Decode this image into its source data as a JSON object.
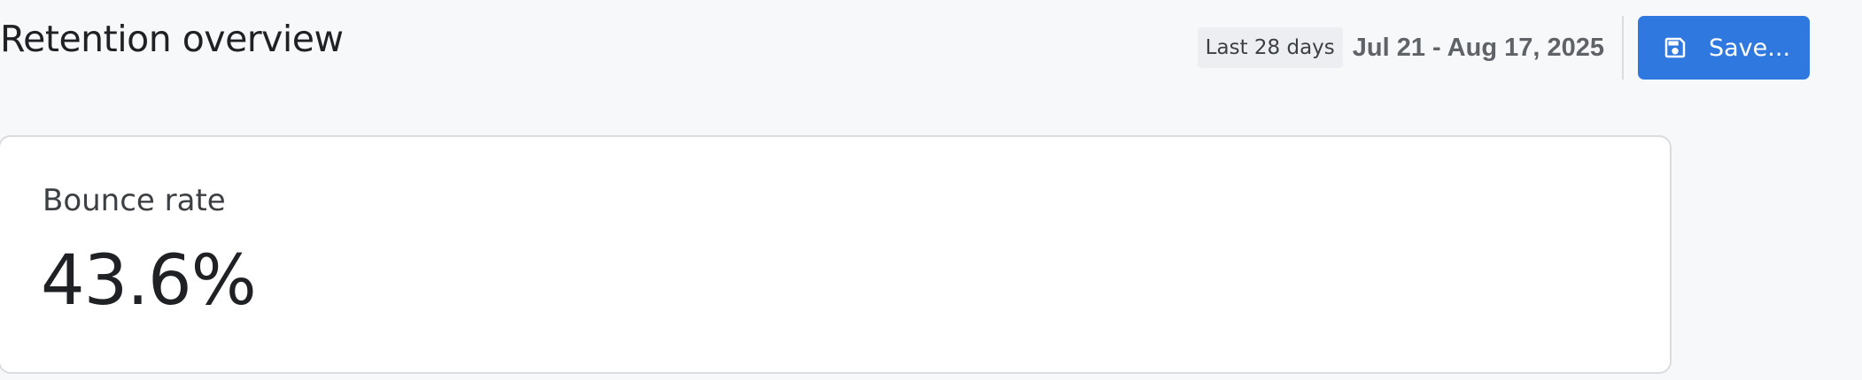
{
  "header": {
    "title": "Retention overview",
    "date_range_preset": "Last 28 days",
    "date_range": "Jul 21 - Aug 17, 2025",
    "save_button": {
      "label": "Save...",
      "icon": "floppy-disk-icon"
    }
  },
  "kpi": {
    "label": "Bounce rate",
    "value": "43.6%"
  },
  "colors": {
    "accent": "#2f78e0",
    "background": "#f7f8fa",
    "card": "#ffffff"
  }
}
